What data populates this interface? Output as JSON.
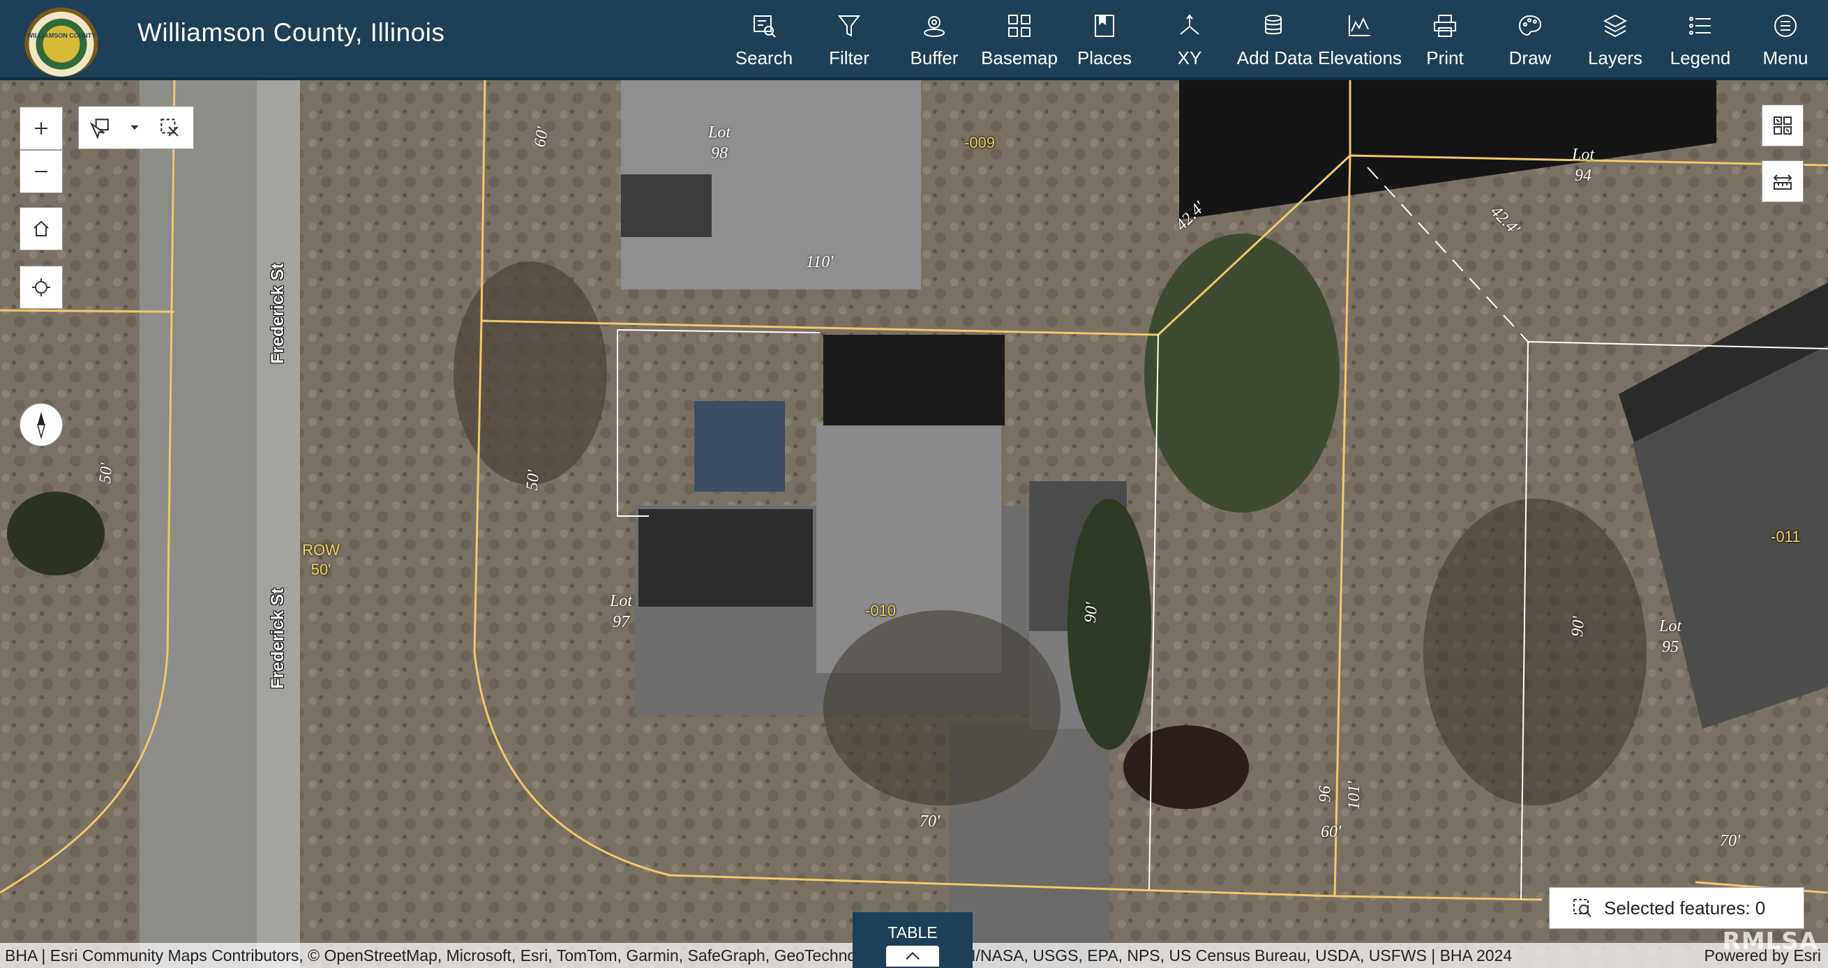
{
  "header": {
    "title": "Williamson County, Illinois",
    "logo_text": "WILLIAMSON COUNTY",
    "tools": [
      {
        "label": "Search",
        "icon": "search-icon"
      },
      {
        "label": "Filter",
        "icon": "filter-icon"
      },
      {
        "label": "Buffer",
        "icon": "buffer-icon"
      },
      {
        "label": "Basemap",
        "icon": "basemap-icon"
      },
      {
        "label": "Places",
        "icon": "places-icon"
      },
      {
        "label": "XY",
        "icon": "xy-icon"
      },
      {
        "label": "Add Data",
        "icon": "add-data-icon"
      },
      {
        "label": "Elevations",
        "icon": "elevations-icon"
      },
      {
        "label": "Print",
        "icon": "print-icon"
      },
      {
        "label": "Draw",
        "icon": "draw-icon"
      },
      {
        "label": "Layers",
        "icon": "layers-icon"
      },
      {
        "label": "Legend",
        "icon": "legend-icon"
      },
      {
        "label": "Menu",
        "icon": "menu-icon"
      }
    ]
  },
  "map": {
    "streets": [
      "Frederick St",
      "Frederick St"
    ],
    "row_label": {
      "line1": "ROW",
      "line2": "50'"
    },
    "lots": {
      "lot98": {
        "line1": "Lot",
        "line2": "98"
      },
      "lot94": {
        "line1": "Lot",
        "line2": "94"
      },
      "lot97": {
        "line1": "Lot",
        "line2": "97"
      },
      "lot95": {
        "line1": "Lot",
        "line2": "95"
      }
    },
    "parcels": {
      "p009": "-009",
      "p010": "-010",
      "p011": "-011"
    },
    "dimensions": {
      "d60a": "60'",
      "d110": "110'",
      "d424a": "42.4'",
      "d424b": "42.4'",
      "d50a": "50'",
      "d50b": "50'",
      "d90a": "90'",
      "d90b": "90'",
      "d70a": "70'",
      "d70b": "70'",
      "d60b": "60'",
      "d96": "96",
      "d101": "101'"
    }
  },
  "selected_features": "Selected features: 0",
  "table_tab": "TABLE",
  "attribution": "BHA | Esri Community Maps Contributors, © OpenStreetMap, Microsoft, Esri, TomTom, Garmin, SafeGraph, GeoTechnologies, Inc, METI/NASA, USGS, EPA, NPS, US Census Bureau, USDA, USFWS | BHA 2024",
  "powered_by": "Powered by Esri",
  "watermark": "RMLSA",
  "colors": {
    "header": "#1d3f57",
    "parcel_line": "#f2c86b",
    "parcel_id": "#f4d35e"
  }
}
